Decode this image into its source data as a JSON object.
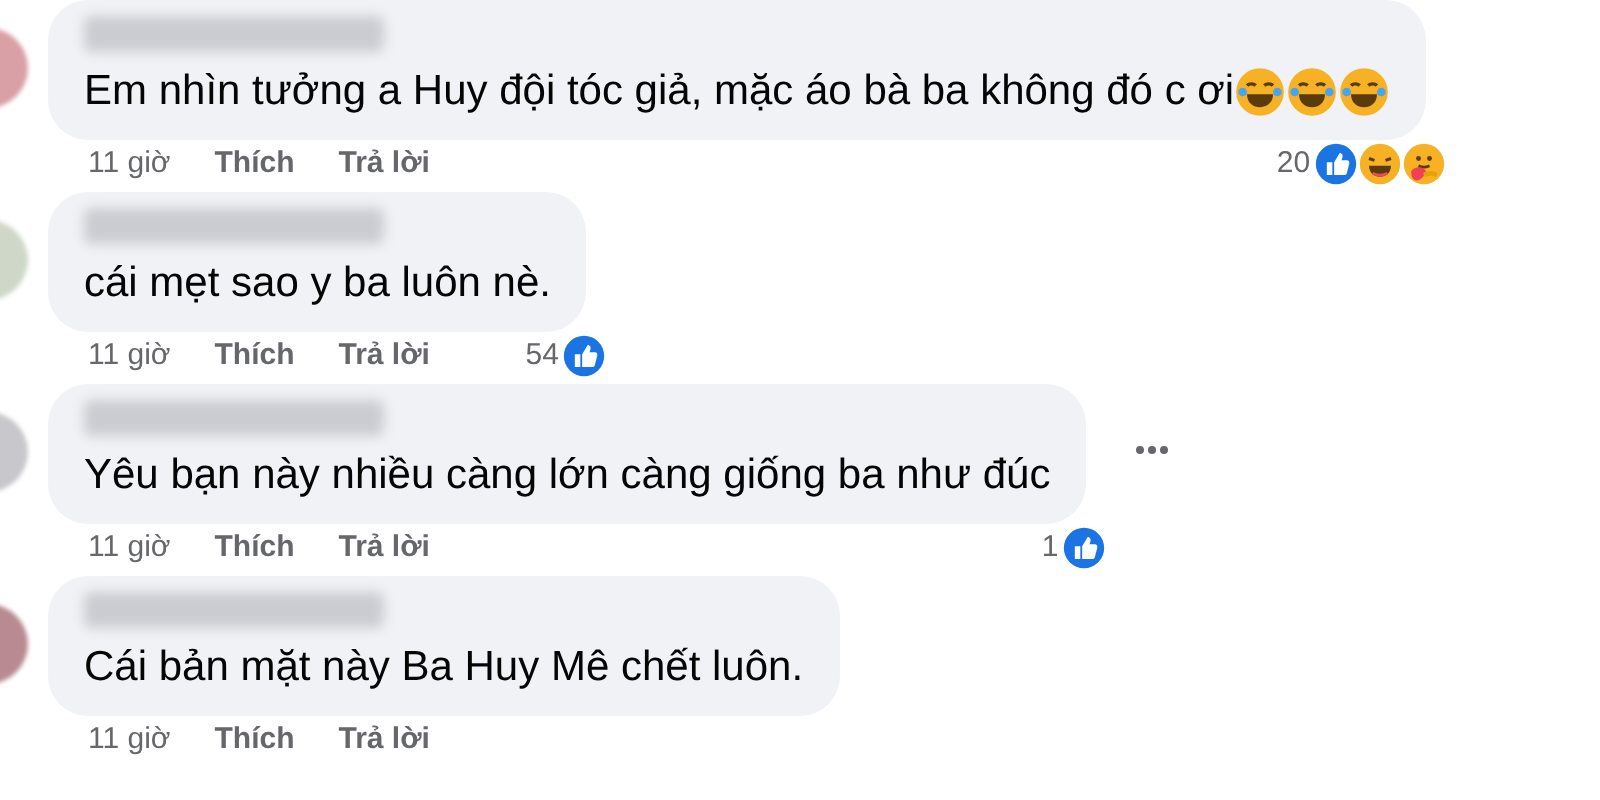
{
  "comments": [
    {
      "text": "Em nhìn tưởng a Huy đội tóc giả, mặc áo bà ba không đó c ơi",
      "trailing_emoji": [
        {
          "kind": "haha"
        },
        {
          "kind": "haha"
        },
        {
          "kind": "haha"
        }
      ],
      "more_menu": false,
      "time": "11 giờ",
      "like": "Thích",
      "reply": "Trả lời",
      "reaction_count": "20",
      "reactions": [
        {
          "kind": "like"
        },
        {
          "kind": "haha"
        },
        {
          "kind": "care"
        }
      ]
    },
    {
      "text": "cái mẹt sao y ba luôn nè.",
      "more_menu": false,
      "time": "11 giờ",
      "like": "Thích",
      "reply": "Trả lời",
      "reaction_count": "54",
      "reactions": [
        {
          "kind": "like"
        }
      ]
    },
    {
      "text": "Yêu bạn này nhiều càng lớn càng giống ba như đúc",
      "more_menu": true,
      "time": "11 giờ",
      "like": "Thích",
      "reply": "Trả lời",
      "reaction_count": "1",
      "reactions": [
        {
          "kind": "like"
        }
      ]
    },
    {
      "text": "Cái bản mặt này Ba Huy Mê chết luôn.",
      "more_menu": false,
      "time": "11 giờ",
      "like": "Thích",
      "reply": "Trả lời"
    }
  ]
}
